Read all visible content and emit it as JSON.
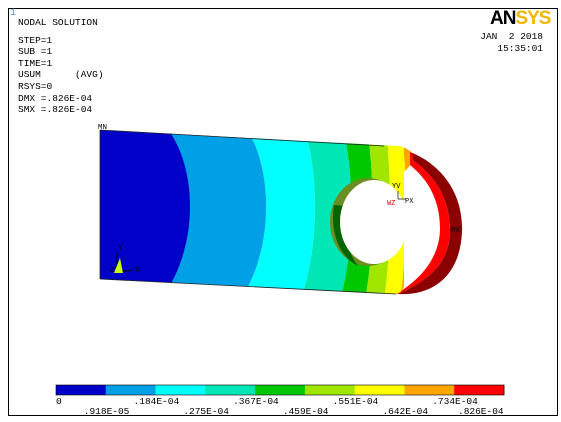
{
  "window_number": "1",
  "logo": {
    "part1": "AN",
    "part2": "SYS"
  },
  "info": {
    "title": "NODAL SOLUTION",
    "step": "STEP=1",
    "sub": "SUB =1",
    "time": "TIME=1",
    "usum": "USUM      (AVG)",
    "rsys": "RSYS=0",
    "dmx": "DMX =.826E-04",
    "smx": "SMX =.826E-04"
  },
  "datetime": {
    "date": "JAN  2 2018",
    "time": "15:35:01"
  },
  "model_labels": {
    "mn": "MN",
    "mx": "MX",
    "triad_y": "Y",
    "triad_z": "Z",
    "triad_x": "X",
    "hole_y": "YV",
    "hole_z": "WZ",
    "hole_x": "PX"
  },
  "legend": {
    "colors": [
      "#0000c8",
      "#00a0e6",
      "#00ffff",
      "#00e6b4",
      "#00c800",
      "#a0e600",
      "#ffff00",
      "#ffa500",
      "#ff0000"
    ],
    "top_labels": [
      "0",
      ".184E-04",
      ".367E-04",
      ".551E-04",
      ".734E-04"
    ],
    "bottom_labels": [
      ".918E-05",
      ".275E-04",
      ".459E-04",
      ".642E-04",
      ".826E-04"
    ]
  },
  "colors": {
    "mx_band": "#8b0000"
  }
}
